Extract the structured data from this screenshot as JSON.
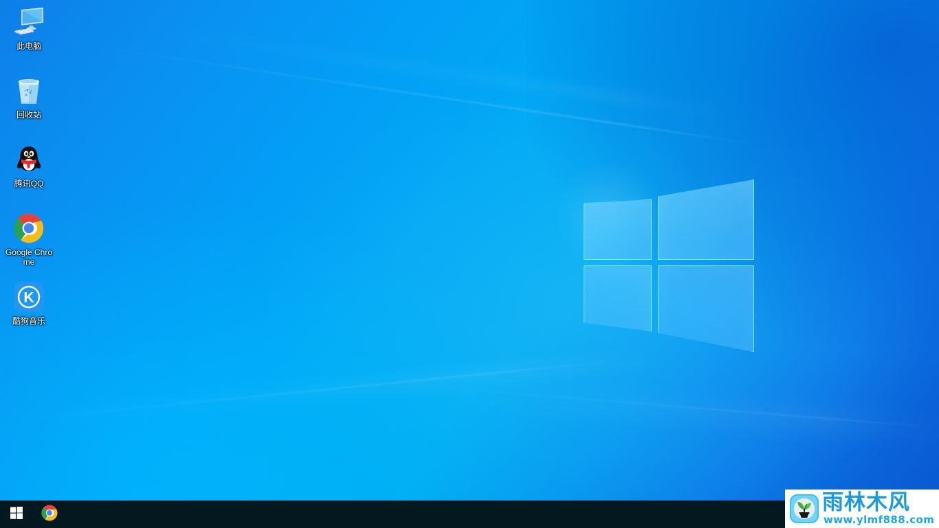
{
  "desktop": {
    "wallpaper_name": "windows-10-hero-wallpaper",
    "colors": {
      "wallpaper_light": "#00acf2",
      "wallpaper_mid": "#0a8ff0",
      "wallpaper_dark": "#0a55cf",
      "pane_stroke": "#82fff0",
      "taskbar": "#041820",
      "icon_label_text": "#ffffff"
    },
    "icons": [
      {
        "label": "此电脑",
        "icon": "this-pc-icon",
        "key": "this-pc"
      },
      {
        "label": "回收站",
        "icon": "recycle-bin-icon",
        "key": "recycle-bin"
      },
      {
        "label": "腾讯QQ",
        "icon": "tencent-qq-icon",
        "key": "tencent-qq"
      },
      {
        "label": "Google Chrome",
        "icon": "google-chrome-icon",
        "key": "google-chrome"
      },
      {
        "label": "酷狗音乐",
        "icon": "kugou-music-icon",
        "key": "kugou-music"
      }
    ]
  },
  "taskbar": {
    "start_label": "开始",
    "items": [
      {
        "label": "开始",
        "icon": "windows-start-icon"
      },
      {
        "label": "Google Chrome",
        "icon": "google-chrome-icon"
      }
    ],
    "tray_items": []
  },
  "watermark": {
    "brand_cn": "雨林木风",
    "url": "www.ylmf888.com",
    "logo_icon": "sprout-logo-icon",
    "brand_color": "#1b9ae0",
    "url_color": "#19a7e8",
    "panel_color": "#ffffff"
  }
}
